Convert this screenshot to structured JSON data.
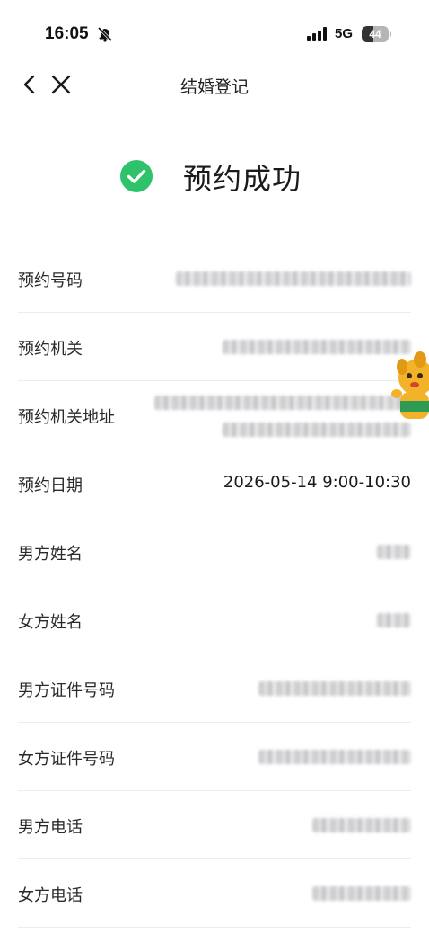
{
  "status_bar": {
    "time": "16:05",
    "network": "5G",
    "battery": "44",
    "battery_level": 0.44
  },
  "nav": {
    "title": "结婚登记",
    "back_icon": "chevron-left-icon",
    "close_icon": "close-icon"
  },
  "result": {
    "title": "预约成功",
    "icon": "check-circle-icon",
    "accent_color": "#2ec26a"
  },
  "fields": [
    {
      "label": "预约号码",
      "value": ""
    },
    {
      "label": "预约机关",
      "value": ""
    },
    {
      "label": "预约机关地址",
      "value": ""
    },
    {
      "label": "预约日期",
      "value": "2026-05-14 9:00-10:30"
    },
    {
      "label": "男方姓名",
      "value": ""
    },
    {
      "label": "女方姓名",
      "value": ""
    },
    {
      "label": "男方证件号码",
      "value": ""
    },
    {
      "label": "女方证件号码",
      "value": ""
    },
    {
      "label": "男方电话",
      "value": ""
    },
    {
      "label": "女方电话",
      "value": ""
    }
  ]
}
